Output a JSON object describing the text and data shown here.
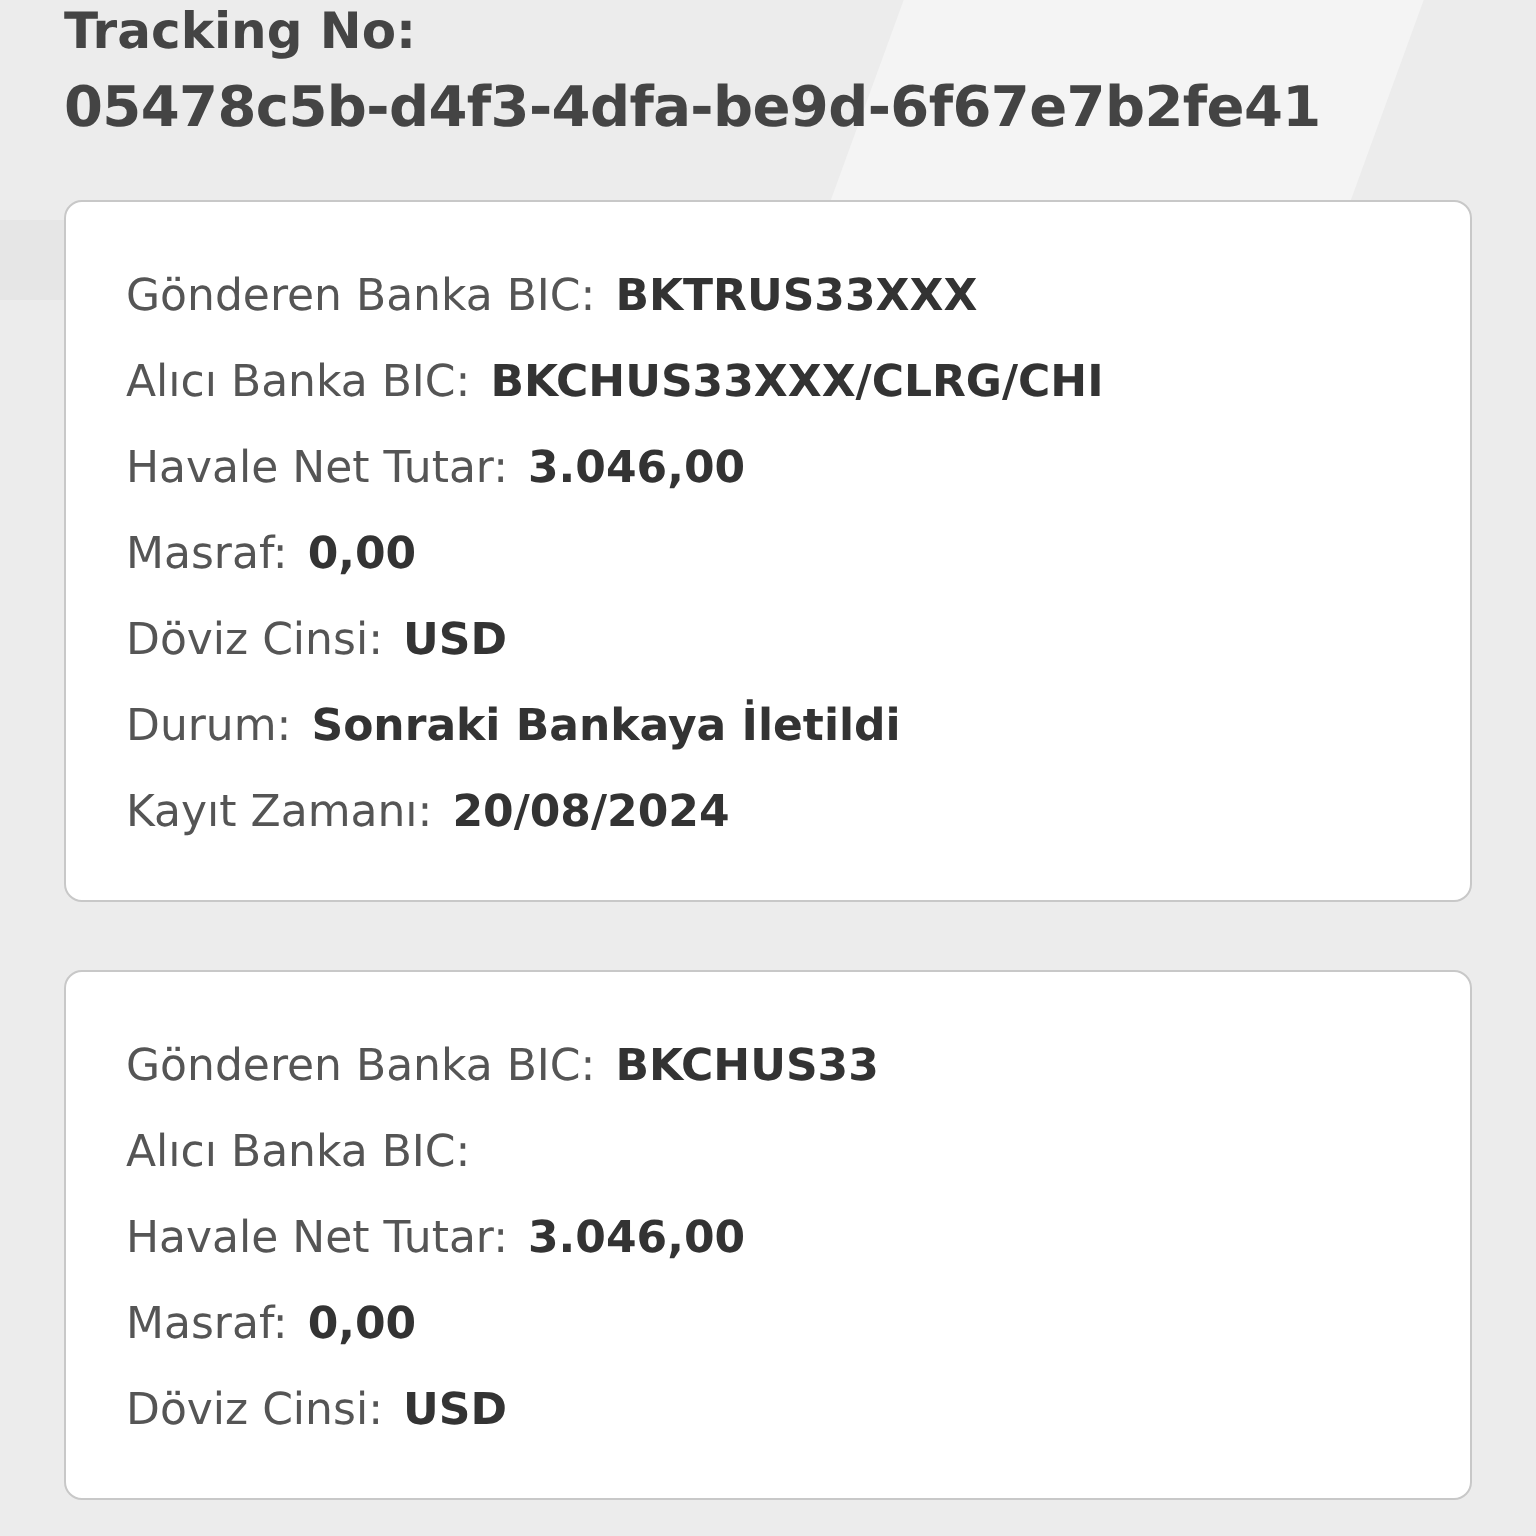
{
  "tracking": {
    "label": "Tracking No:",
    "value": "05478c5b-d4f3-4dfa-be9d-6f67e7b2fe41"
  },
  "cards": [
    {
      "rows": [
        {
          "label": "Gönderen Banka BIC:",
          "value": "BKTRUS33XXX"
        },
        {
          "label": "Alıcı Banka BIC:",
          "value": "BKCHUS33XXX/CLRG/CHI"
        },
        {
          "label": "Havale Net Tutar:",
          "value": "3.046,00"
        },
        {
          "label": "Masraf:",
          "value": "0,00"
        },
        {
          "label": "Döviz Cinsi:",
          "value": "USD"
        },
        {
          "label": "Durum:",
          "value": "Sonraki Bankaya İletildi"
        },
        {
          "label": "Kayıt Zamanı:",
          "value": "20/08/2024"
        }
      ]
    },
    {
      "rows": [
        {
          "label": "Gönderen Banka BIC:",
          "value": "BKCHUS33"
        },
        {
          "label": "Alıcı Banka BIC:"
        },
        {
          "label": "Havale Net Tutar:",
          "value": "3.046,00"
        },
        {
          "label": "Masraf:",
          "value": "0,00"
        },
        {
          "label": "Döviz Cinsi:",
          "value": "USD"
        }
      ]
    }
  ]
}
